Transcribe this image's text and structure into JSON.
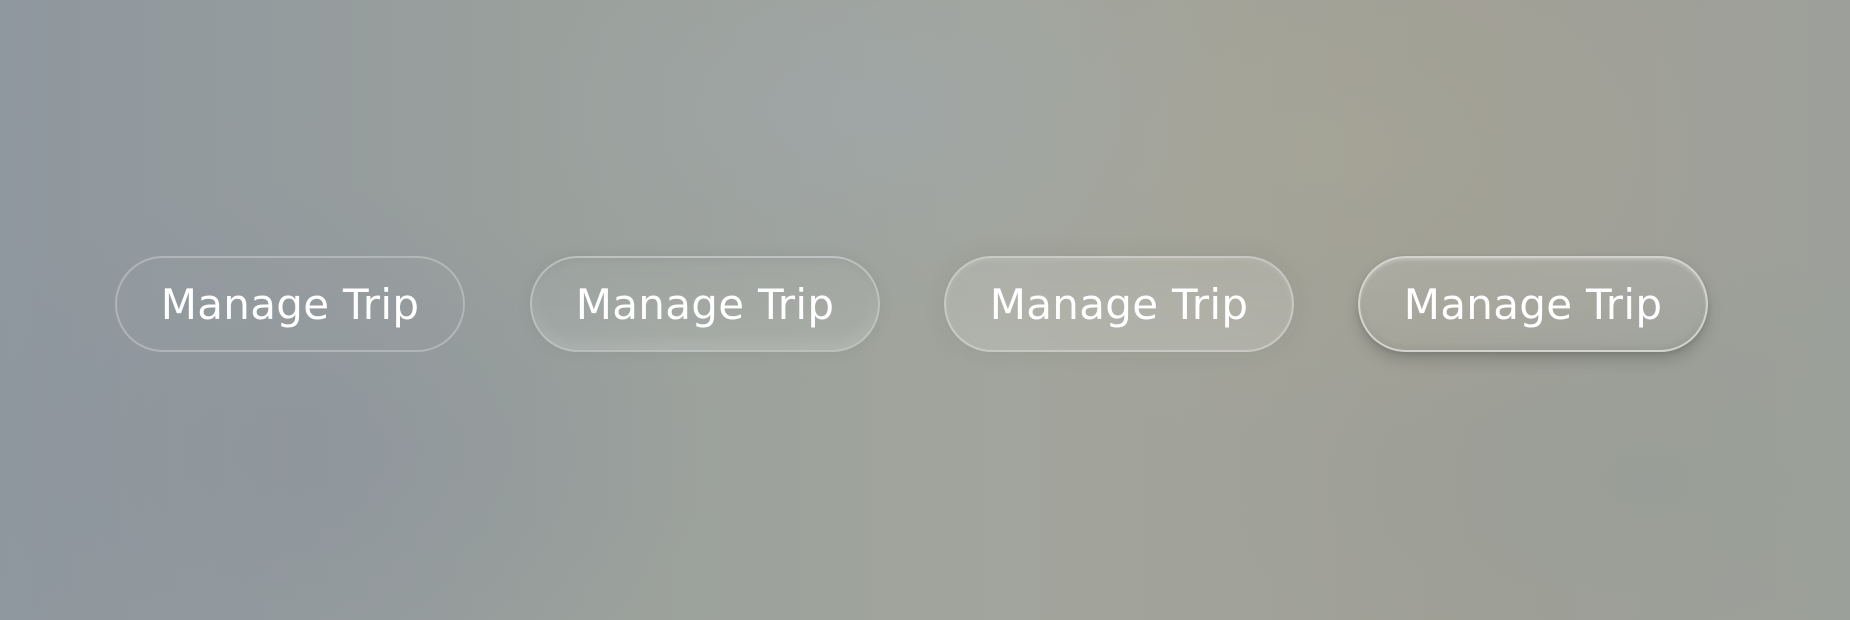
{
  "buttons": [
    {
      "label": "Manage Trip"
    },
    {
      "label": "Manage Trip"
    },
    {
      "label": "Manage Trip"
    },
    {
      "label": "Manage Trip"
    }
  ]
}
